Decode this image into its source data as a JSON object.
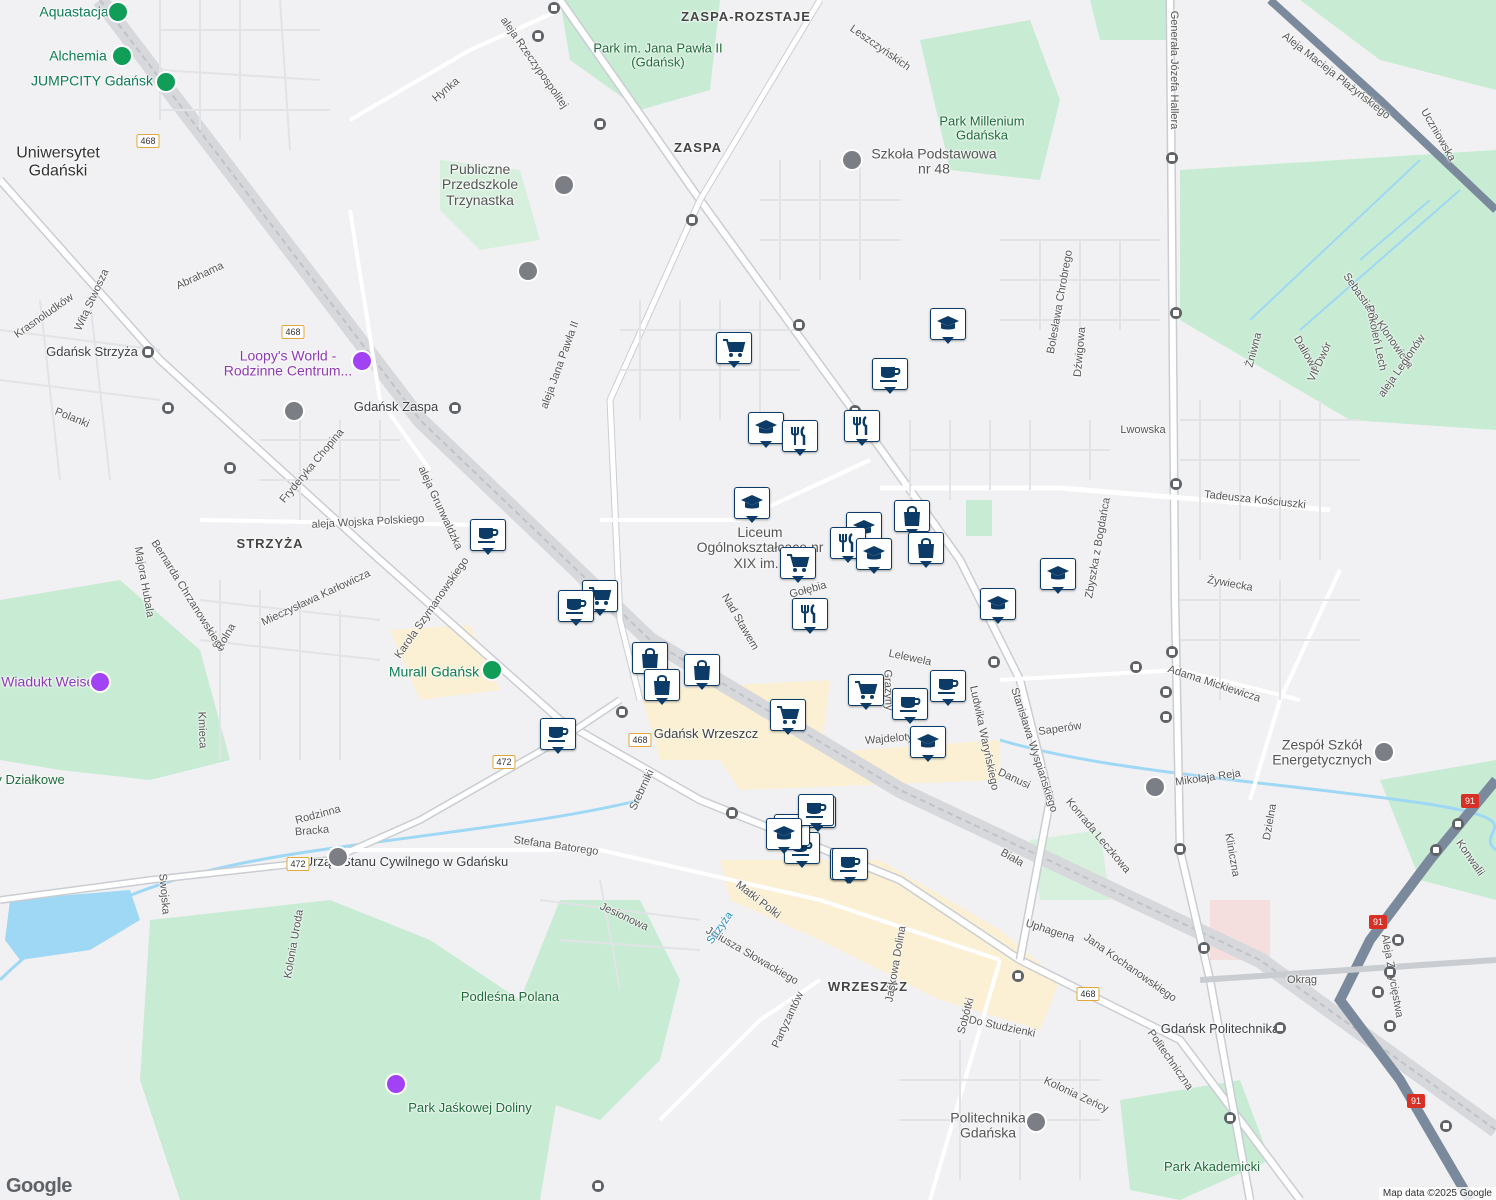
{
  "labels": [
    {
      "text": "Aquastacja",
      "type": "poi-green"
    },
    {
      "text": "Alchemia",
      "type": "poi-green"
    },
    {
      "text": "JUMPCITY Gdańsk",
      "type": "poi-green"
    },
    {
      "text": "Uniwersytet Gdański",
      "type": "big"
    },
    {
      "text": "Park im. Jana Pawła II (Gdańsk)",
      "type": "park"
    },
    {
      "text": "ZASPA-ROZSTAJE",
      "type": "district"
    },
    {
      "text": "ZASPA",
      "type": "district"
    },
    {
      "text": "Park Millenium Gdańska",
      "type": "park"
    },
    {
      "text": "Szkoła Podstawowa nr 48",
      "type": "school"
    },
    {
      "text": "Publiczne Przedszkole Trzynastka",
      "type": "school"
    },
    {
      "text": "Loopy's World - Rodzinne Centrum...",
      "type": "poi-purple"
    },
    {
      "text": "Gdańsk Strzyża",
      "type": "normal"
    },
    {
      "text": "Gdańsk Zaspa",
      "type": "normal"
    },
    {
      "text": "STRZYŻA",
      "type": "district"
    },
    {
      "text": "Murall Gdańsk",
      "type": "poi-green"
    },
    {
      "text": "Wiadukt Weisera",
      "type": "poi-purple"
    },
    {
      "text": "Liceum Ogólnokształcące nr XIX im...",
      "type": "school"
    },
    {
      "text": "Gdańsk Wrzeszcz",
      "type": "normal"
    },
    {
      "text": "Urząd Stanu Cywilnego w Gdańsku",
      "type": "normal"
    },
    {
      "text": "Podleśna Polana",
      "type": "park"
    },
    {
      "text": "Park Jaśkowej Doliny",
      "type": "park"
    },
    {
      "text": "WRZESZCZ",
      "type": "district"
    },
    {
      "text": "Gdańsk Politechnika",
      "type": "normal"
    },
    {
      "text": "Politechnika Gdańska",
      "type": "school"
    },
    {
      "text": "Park Akademicki",
      "type": "park"
    },
    {
      "text": "Zespół Szkół Energetycznych",
      "type": "school"
    },
    {
      "text": "Ogrody Działkowe",
      "type": "park"
    },
    {
      "text": "Hynka",
      "type": "street"
    },
    {
      "text": "aleja Rzeczypospolitej",
      "type": "street"
    },
    {
      "text": "Leszczyńskich",
      "type": "street"
    },
    {
      "text": "Generała Józefa Hallera",
      "type": "street"
    },
    {
      "text": "Aleja Macieja Płażyńskiego",
      "type": "street"
    },
    {
      "text": "Uczniowska",
      "type": "street"
    },
    {
      "text": "Witą Stwosza",
      "type": "street"
    },
    {
      "text": "Abrahama",
      "type": "street"
    },
    {
      "text": "Krasnoludków",
      "type": "street"
    },
    {
      "text": "aleja Jana Pawła II",
      "type": "street"
    },
    {
      "text": "Polanki",
      "type": "street"
    },
    {
      "text": "Fryderyka Chopina",
      "type": "street"
    },
    {
      "text": "aleja Grunwaldzka",
      "type": "street"
    },
    {
      "text": "aleja Wojska Polskiego",
      "type": "street"
    },
    {
      "text": "Bernarda Chrzanowskiego",
      "type": "street"
    },
    {
      "text": "Majora Hubala",
      "type": "street"
    },
    {
      "text": "Mieczysława Karłowicza",
      "type": "street"
    },
    {
      "text": "Karola Szymanowskiego",
      "type": "street"
    },
    {
      "text": "Rolna",
      "type": "street"
    },
    {
      "text": "Kmieca",
      "type": "street"
    },
    {
      "text": "Nad Stawem",
      "type": "street"
    },
    {
      "text": "Gołębia",
      "type": "street"
    },
    {
      "text": "Lelewela",
      "type": "street"
    },
    {
      "text": "Grażyny",
      "type": "street"
    },
    {
      "text": "Wajdeloty",
      "type": "street"
    },
    {
      "text": "Saperów",
      "type": "street"
    },
    {
      "text": "Danusi",
      "type": "street"
    },
    {
      "text": "Tadeusza Kościuszki",
      "type": "street"
    },
    {
      "text": "Lwowska",
      "type": "street"
    },
    {
      "text": "Bolesława Chrobrego",
      "type": "street"
    },
    {
      "text": "Dźwigowa",
      "type": "street"
    },
    {
      "text": "Żywiecka",
      "type": "street"
    },
    {
      "text": "Zbyszka z Bogdańca",
      "type": "street"
    },
    {
      "text": "Adama Mickiewicza",
      "type": "street"
    },
    {
      "text": "Mikołaja Reja",
      "type": "street"
    },
    {
      "text": "Konrada Leczkowa",
      "type": "street"
    },
    {
      "text": "Ludwika Waryńskiego",
      "type": "street"
    },
    {
      "text": "Stanisława Wyspiańskiego",
      "type": "street"
    },
    {
      "text": "Biała",
      "type": "street"
    },
    {
      "text": "Uphagena",
      "type": "street"
    },
    {
      "text": "Jana Kochanowskiego",
      "type": "street"
    },
    {
      "text": "Dzielna",
      "type": "street"
    },
    {
      "text": "Kliniczna",
      "type": "street"
    },
    {
      "text": "Okrąg",
      "type": "street"
    },
    {
      "text": "Aleja Zwycięstwa",
      "type": "street"
    },
    {
      "text": "Politechniczna",
      "type": "street"
    },
    {
      "text": "Do Studzienki",
      "type": "street"
    },
    {
      "text": "Sobótki",
      "type": "street"
    },
    {
      "text": "Jaśkowa Dolina",
      "type": "street"
    },
    {
      "text": "Partyzantów",
      "type": "street"
    },
    {
      "text": "Stefana Batorego",
      "type": "street"
    },
    {
      "text": "Matki Polki",
      "type": "street"
    },
    {
      "text": "Jesionowa",
      "type": "street"
    },
    {
      "text": "Juliusza Słowackiego",
      "type": "street"
    },
    {
      "text": "Strzyża",
      "type": "water"
    },
    {
      "text": "Srebrniki",
      "type": "street"
    },
    {
      "text": "Rodzinna",
      "type": "street"
    },
    {
      "text": "Bracka",
      "type": "street"
    },
    {
      "text": "Swojska",
      "type": "street"
    },
    {
      "text": "Kolonia Uroda",
      "type": "street"
    },
    {
      "text": "Kolonia Zeńcy",
      "type": "street"
    },
    {
      "text": "Konwalii",
      "type": "street"
    },
    {
      "text": "Żniwna",
      "type": "street"
    },
    {
      "text": "Daliowa",
      "type": "street"
    },
    {
      "text": "Sebastiana Klonowicza",
      "type": "street"
    },
    {
      "text": "Pokoleń Lech",
      "type": "street"
    },
    {
      "text": "VII Dwór",
      "type": "street"
    },
    {
      "text": "aleja Legionów",
      "type": "street"
    }
  ],
  "shields": [
    "468",
    "468",
    "468",
    "472",
    "472",
    "468",
    "91",
    "91",
    "91"
  ],
  "pins": [
    "school",
    "cart",
    "school",
    "food",
    "food",
    "school",
    "bag",
    "school",
    "food",
    "school",
    "bag",
    "cart",
    "food",
    "cart",
    "cup",
    "cup",
    "school",
    "school",
    "cup",
    "bag",
    "bag",
    "bag",
    "cup",
    "cart",
    "cup",
    "cart",
    "school",
    "cup",
    "school",
    "cup",
    "school",
    "cup",
    "cup",
    "school",
    "cup"
  ],
  "attribution": "Map data ©2025 Google",
  "logo": "Google"
}
